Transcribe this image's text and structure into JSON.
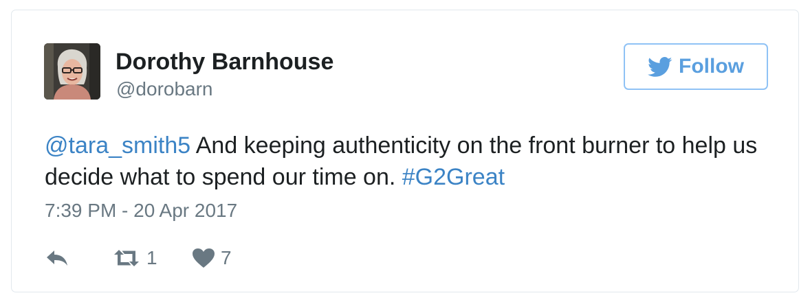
{
  "tweet": {
    "author": {
      "name": "Dorothy Barnhouse",
      "handle": "@dorobarn"
    },
    "follow_label": "Follow",
    "text": {
      "mention": "@tara_smith5",
      "body": " And keeping authenticity on the front burner to help us decide what to spend our time on. ",
      "hashtag": "#G2Great"
    },
    "timestamp": "7:39 PM - 20 Apr 2017",
    "actions": {
      "reply_icon": "reply-icon",
      "retweet_icon": "retweet-icon",
      "retweet_count": "1",
      "like_icon": "heart-icon",
      "like_count": "7"
    }
  },
  "colors": {
    "link": "#3b83c5",
    "follow_border": "#8fc2f5",
    "follow_text": "#5a9fdf",
    "secondary_text": "#697882",
    "card_border": "#e1e8ed"
  }
}
